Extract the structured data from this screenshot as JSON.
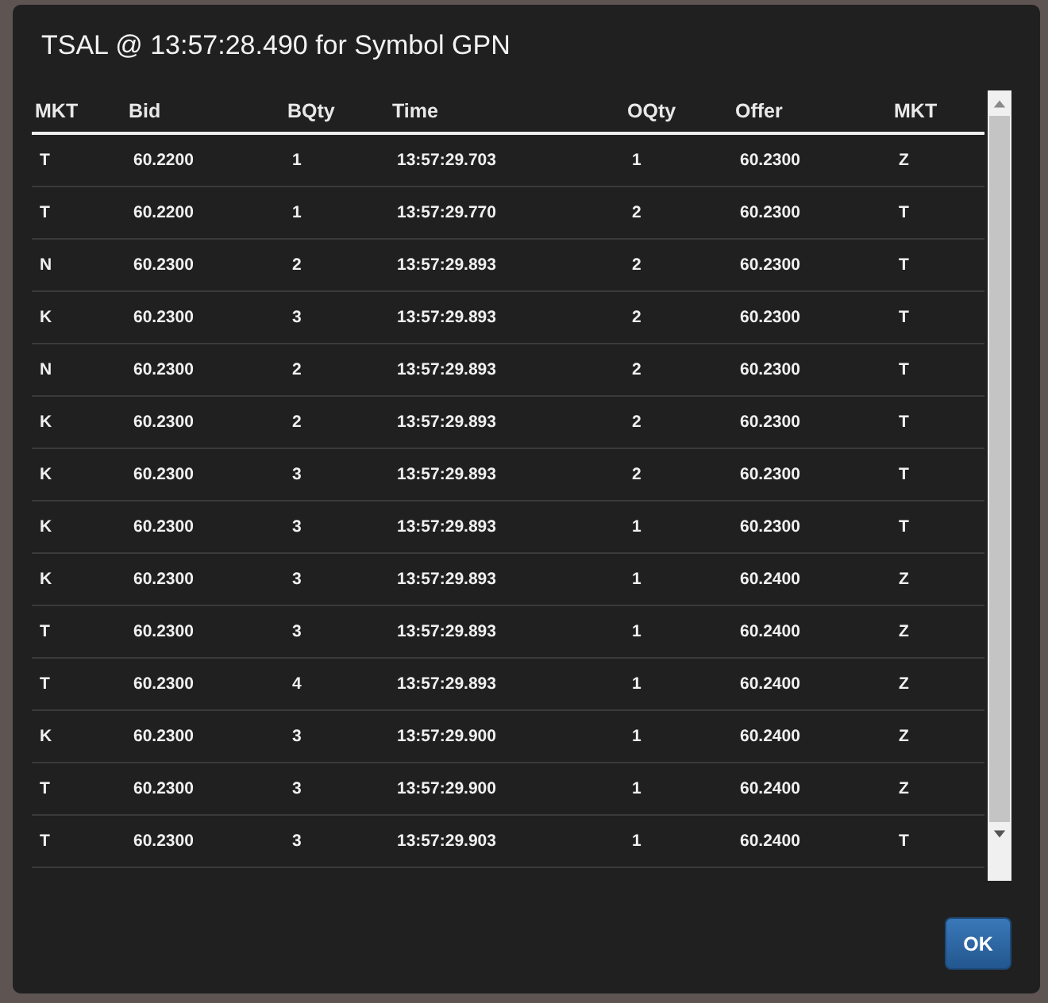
{
  "dialog": {
    "title": "TSAL @ 13:57:28.490 for Symbol GPN",
    "table": {
      "columns": [
        "MKT",
        "Bid",
        "BQty",
        "Time",
        "OQty",
        "Offer",
        "MKT"
      ],
      "rows": [
        [
          "T",
          "60.2200",
          "1",
          "13:57:29.703",
          "1",
          "60.2300",
          "Z"
        ],
        [
          "T",
          "60.2200",
          "1",
          "13:57:29.770",
          "2",
          "60.2300",
          "T"
        ],
        [
          "N",
          "60.2300",
          "2",
          "13:57:29.893",
          "2",
          "60.2300",
          "T"
        ],
        [
          "K",
          "60.2300",
          "3",
          "13:57:29.893",
          "2",
          "60.2300",
          "T"
        ],
        [
          "N",
          "60.2300",
          "2",
          "13:57:29.893",
          "2",
          "60.2300",
          "T"
        ],
        [
          "K",
          "60.2300",
          "2",
          "13:57:29.893",
          "2",
          "60.2300",
          "T"
        ],
        [
          "K",
          "60.2300",
          "3",
          "13:57:29.893",
          "2",
          "60.2300",
          "T"
        ],
        [
          "K",
          "60.2300",
          "3",
          "13:57:29.893",
          "1",
          "60.2300",
          "T"
        ],
        [
          "K",
          "60.2300",
          "3",
          "13:57:29.893",
          "1",
          "60.2400",
          "Z"
        ],
        [
          "T",
          "60.2300",
          "3",
          "13:57:29.893",
          "1",
          "60.2400",
          "Z"
        ],
        [
          "T",
          "60.2300",
          "4",
          "13:57:29.893",
          "1",
          "60.2400",
          "Z"
        ],
        [
          "K",
          "60.2300",
          "3",
          "13:57:29.900",
          "1",
          "60.2400",
          "Z"
        ],
        [
          "T",
          "60.2300",
          "3",
          "13:57:29.900",
          "1",
          "60.2400",
          "Z"
        ],
        [
          "T",
          "60.2300",
          "3",
          "13:57:29.903",
          "1",
          "60.2400",
          "T"
        ]
      ]
    },
    "buttons": [
      "OK"
    ]
  }
}
